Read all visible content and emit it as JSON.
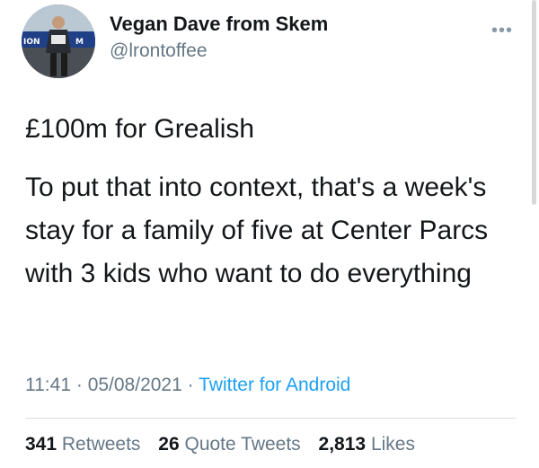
{
  "user": {
    "display_name": "Vegan Dave from Skem",
    "handle": "@lrontoffee"
  },
  "tweet": {
    "paragraphs": [
      "£100m for Grealish",
      "To put that into context, that's a week's stay for a family of five at Center Parcs with 3 kids who want to do everything"
    ],
    "time": "11:41",
    "date": "05/08/2021",
    "source": "Twitter for Android",
    "separator": "·"
  },
  "stats": {
    "retweets": {
      "count": "341",
      "label": "Retweets"
    },
    "quote_tweets": {
      "count": "26",
      "label": "Quote Tweets"
    },
    "likes": {
      "count": "2,813",
      "label": "Likes"
    }
  },
  "icons": {
    "more": "more-options-icon",
    "avatar": "profile-photo"
  },
  "colors": {
    "link": "#1da1f2",
    "secondary_text": "#657786",
    "primary_text": "#14171a"
  }
}
